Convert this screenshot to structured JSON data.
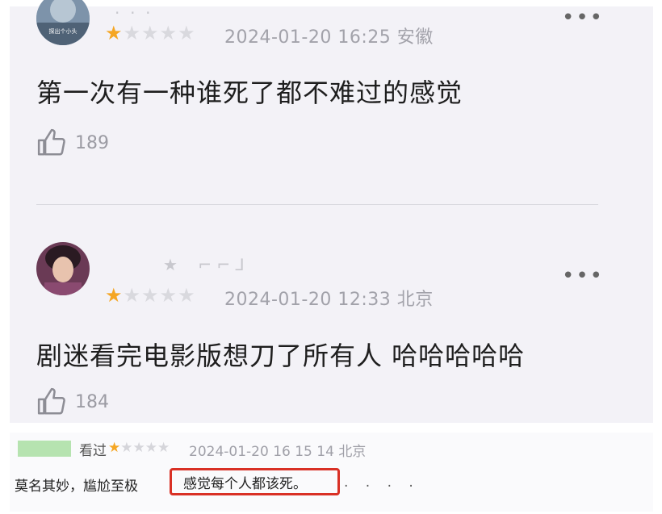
{
  "comments": [
    {
      "avatar_caption": "探出个小头",
      "rating": 1,
      "max_rating": 5,
      "date": "2024-01-20 16:25",
      "location": "安徽",
      "content": "第一次有一种谁死了都不难过的感觉",
      "likes": "189",
      "more": "•••",
      "icons": {
        "avatar": "user-avatar-icon",
        "like": "thumbs-up-icon",
        "more": "more-dots-icon",
        "star": "star-icon"
      }
    },
    {
      "avatar_caption": "",
      "rating": 1,
      "max_rating": 5,
      "date": "2024-01-20 12:33",
      "location": "北京",
      "content": "剧迷看完电影版想刀了所有人 哈哈哈哈哈",
      "likes": "184",
      "more": "•••",
      "icons": {
        "avatar": "user-avatar-icon",
        "like": "thumbs-up-icon",
        "more": "more-dots-icon",
        "star": "star-icon"
      }
    }
  ],
  "review": {
    "status": "看过",
    "rating": 1,
    "max_rating": 5,
    "datetime": "2024-01-20 16 15 14",
    "location": "北京",
    "text_before": "莫名其妙，尴尬至极",
    "text_highlighted": "感觉每个人都该死。",
    "text_after": ". . . .",
    "colors": {
      "star": "#f5a623",
      "highlight_border": "#d93025",
      "name_mask": "#b6e3b0"
    }
  }
}
